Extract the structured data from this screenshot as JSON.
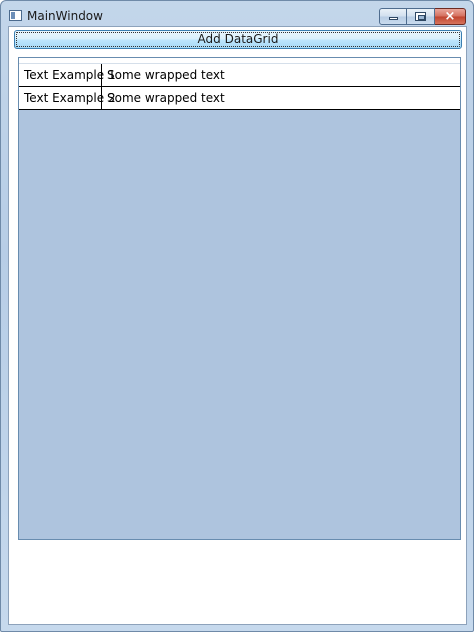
{
  "window": {
    "title": "MainWindow",
    "icon": "window-app-icon",
    "controls": {
      "minimize": "minimize-icon",
      "maximize": "maximize-icon",
      "close": "×"
    }
  },
  "toolbar": {
    "add_datagrid_label": "Add DataGrid"
  },
  "datagrid": {
    "columns": [
      "",
      ""
    ],
    "rows": [
      [
        "Text Example 1",
        "Some wrapped text"
      ],
      [
        "Text Example 2",
        "Some wrapped text"
      ]
    ],
    "background_color": "#aec4de"
  }
}
